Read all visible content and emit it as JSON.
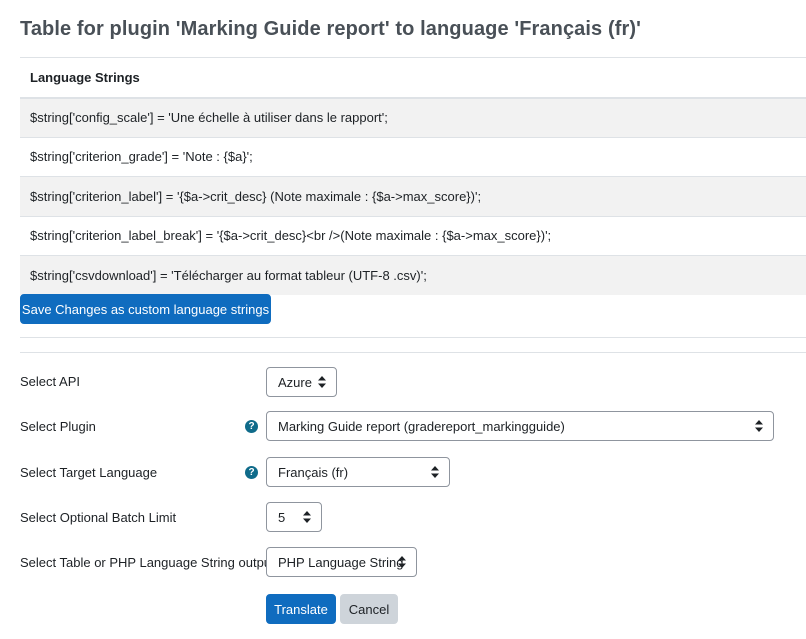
{
  "page": {
    "title": "Table for plugin 'Marking Guide report' to language 'Français (fr)'"
  },
  "strings_table": {
    "header": "Language Strings",
    "rows": [
      "$string['config_scale'] = 'Une échelle à utiliser dans le rapport';",
      "$string['criterion_grade'] = 'Note : {$a}';",
      "$string['criterion_label'] = '{$a->crit_desc} (Note maximale : {$a->max_score})';",
      "$string['criterion_label_break'] = '{$a->crit_desc}<br />(Note maximale : {$a->max_score})';",
      "$string['csvdownload'] = 'Télécharger au format tableur (UTF-8 .csv)';"
    ]
  },
  "save_button": {
    "label": "Save Changes as custom language strings"
  },
  "form": {
    "api": {
      "label": "Select API",
      "value": "Azure"
    },
    "plugin": {
      "label": "Select Plugin",
      "value": "Marking Guide report (gradereport_markingguide)"
    },
    "target_language": {
      "label": "Select Target Language",
      "value": "Français (fr)"
    },
    "batch_limit": {
      "label": "Select Optional Batch Limit",
      "value": "5"
    },
    "output": {
      "label": "Select Table or PHP Language String output",
      "value": "PHP Language String"
    }
  },
  "buttons": {
    "translate": "Translate",
    "cancel": "Cancel"
  },
  "icons": {
    "help": "question-circle-icon",
    "select_caret": "sort-caret-icon"
  },
  "colors": {
    "primary": "#0f6cbf",
    "help_icon": "#0f6b8a",
    "title": "#495057",
    "row_stripe": "#f2f2f2"
  }
}
